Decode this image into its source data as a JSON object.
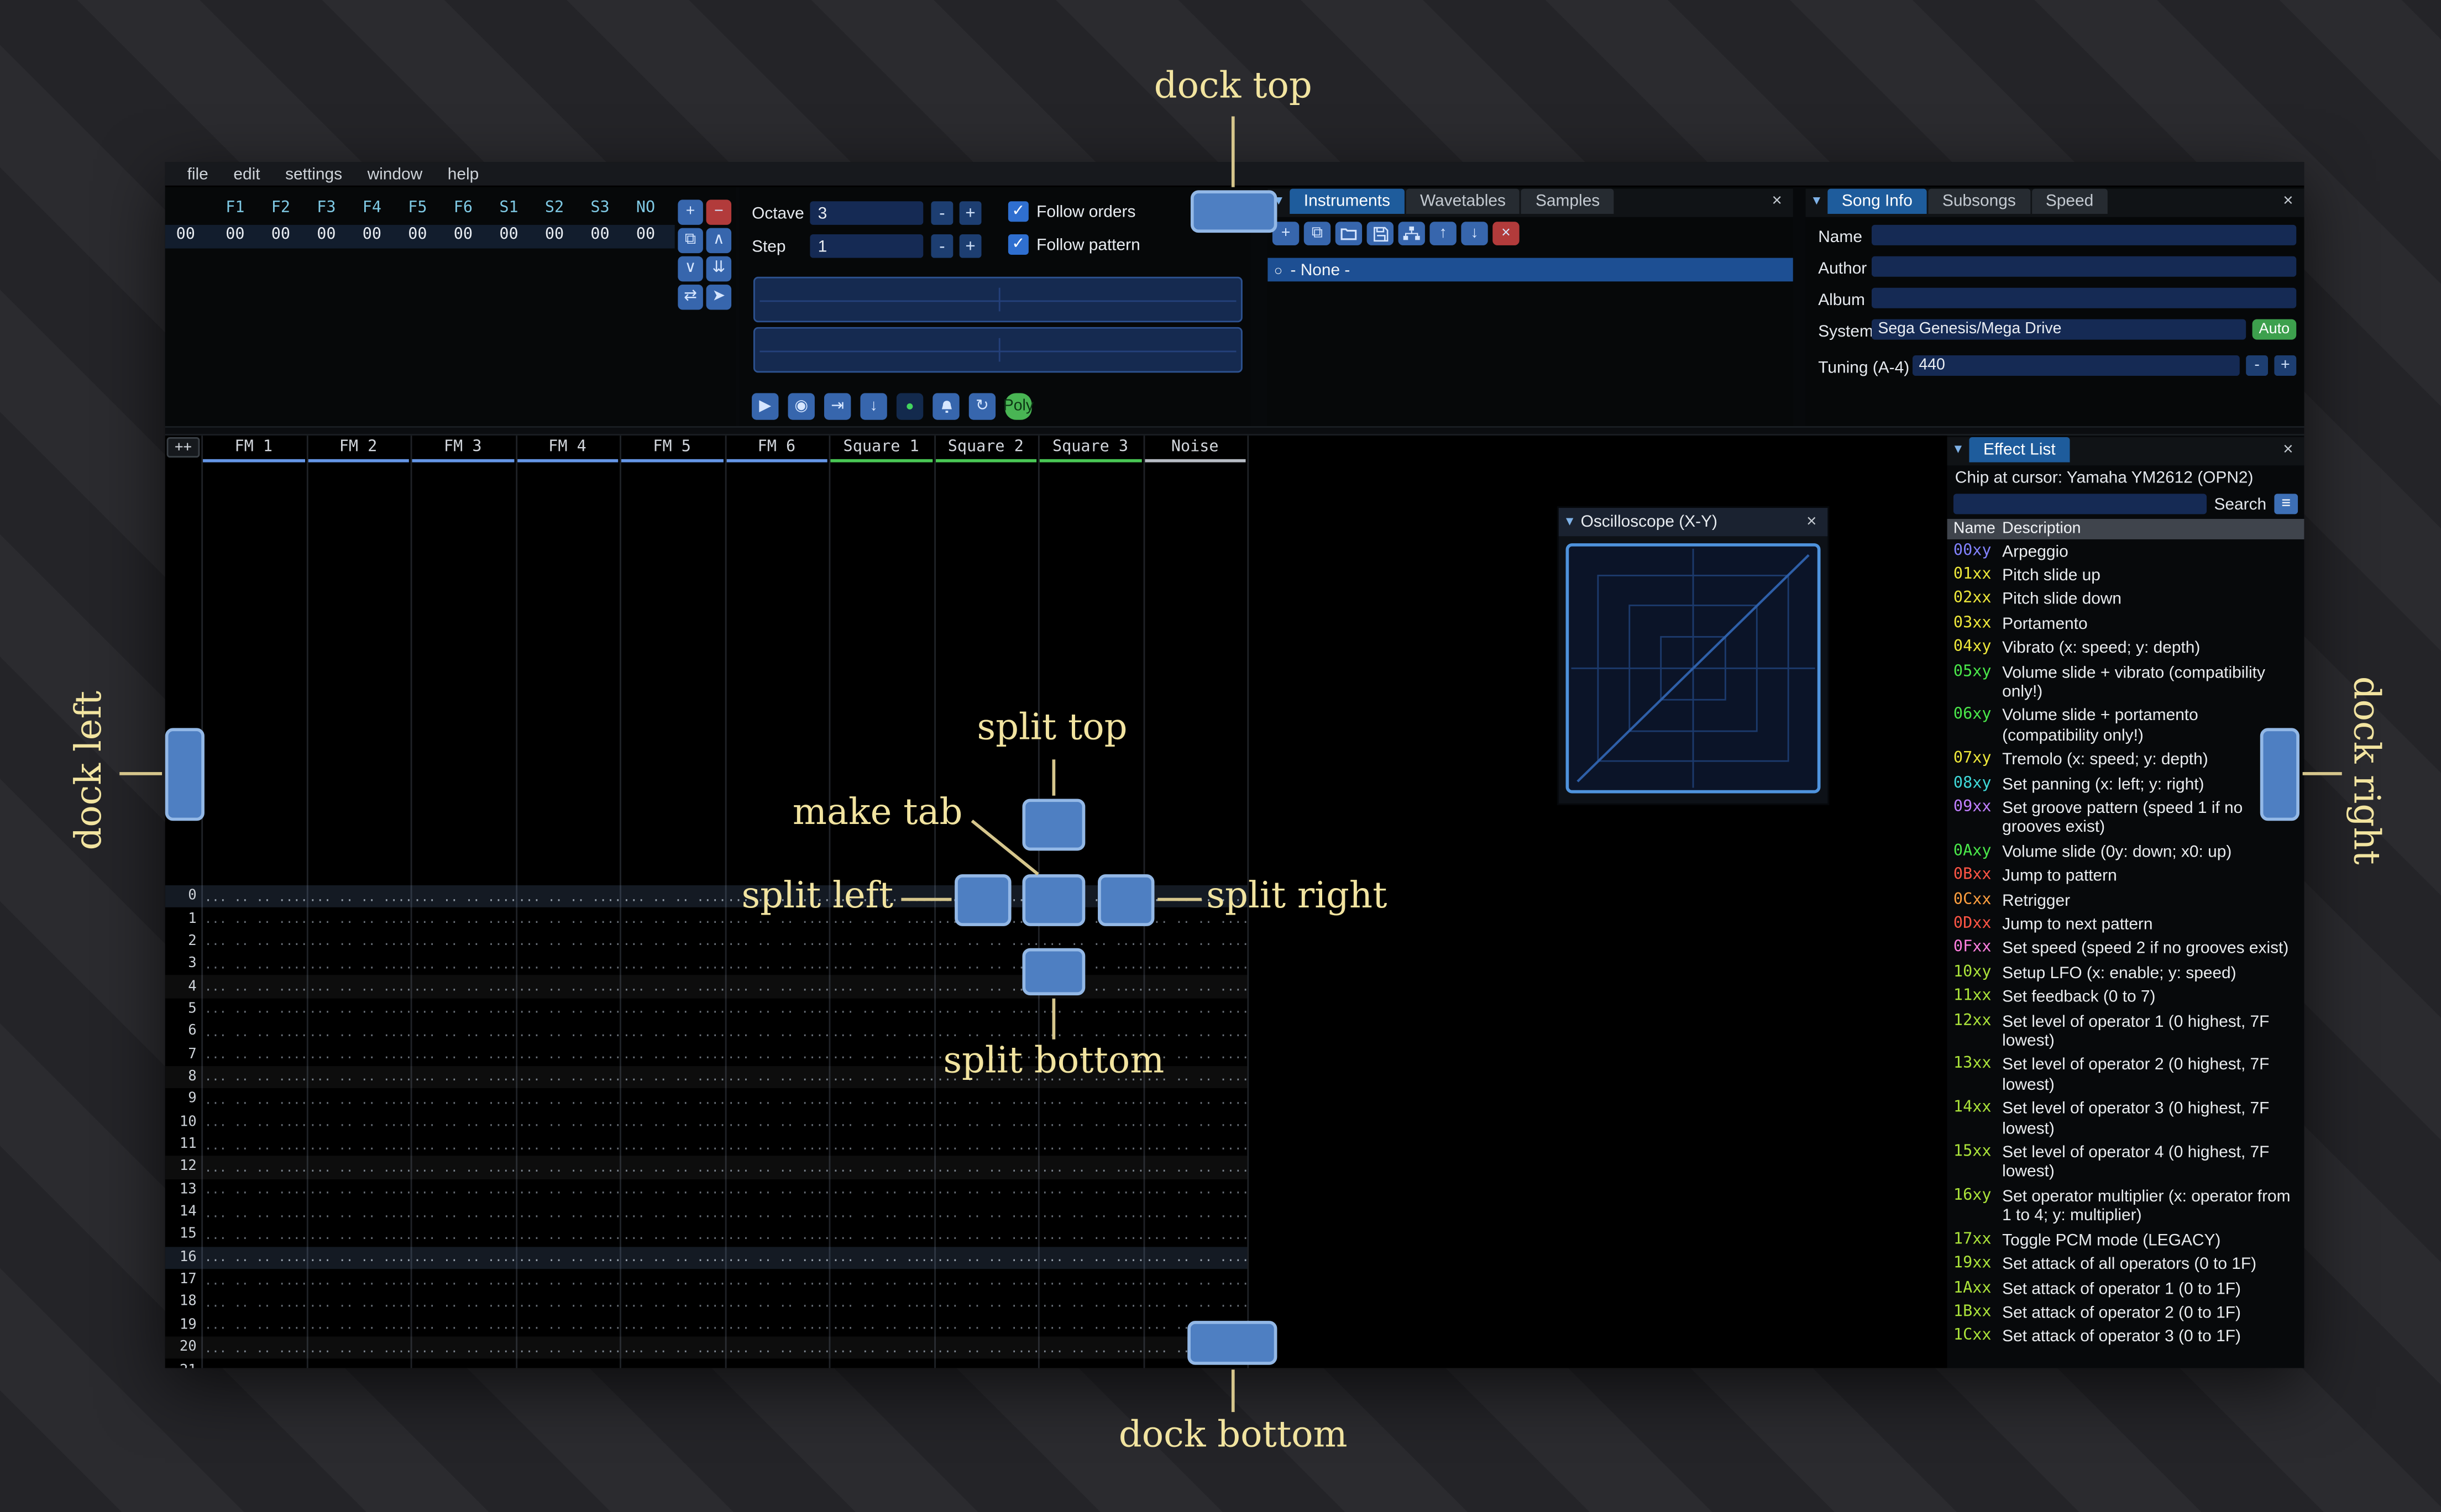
{
  "glyphs": {
    "collapse": "▼",
    "close": "×",
    "check": "✓",
    "radio": "○",
    "burger": "≡"
  },
  "menu": {
    "items": [
      "file",
      "edit",
      "settings",
      "window",
      "help"
    ]
  },
  "order_list": {
    "columns": [
      "F1",
      "F2",
      "F3",
      "F4",
      "F5",
      "F6",
      "S1",
      "S2",
      "S3",
      "NO"
    ],
    "row_index": "00",
    "row_values": [
      "00",
      "00",
      "00",
      "00",
      "00",
      "00",
      "00",
      "00",
      "00",
      "00"
    ],
    "buttons": [
      {
        "name": "order-add-button",
        "glyph": "+"
      },
      {
        "name": "order-remove-button",
        "glyph": "−",
        "variant": "danger"
      },
      {
        "name": "order-duplicate-button",
        "glyph": "⧉"
      },
      {
        "name": "order-move-up-button",
        "glyph": "∧"
      },
      {
        "name": "order-move-down-button",
        "glyph": "∨"
      },
      {
        "name": "order-duplicate-end-button",
        "glyph": "⇊"
      },
      {
        "name": "order-change-mode-button",
        "glyph": "⇄"
      },
      {
        "name": "order-edit-mode-button",
        "glyph": "➤"
      }
    ]
  },
  "playback": {
    "octave_label": "Octave",
    "octave_value": "3",
    "step_label": "Step",
    "step_value": "1",
    "minus_label": "-",
    "plus_label": "+",
    "follow_orders_label": "Follow orders",
    "follow_pattern_label": "Follow pattern",
    "transport": [
      {
        "name": "play-button",
        "glyph": "▶"
      },
      {
        "name": "play-from-start-button",
        "glyph": "◉"
      },
      {
        "name": "play-from-cursor-button",
        "glyph": "⇥"
      },
      {
        "name": "step-row-button",
        "glyph": "↓"
      },
      {
        "name": "edit-toggle-button",
        "glyph": "●",
        "variant": "edit"
      },
      {
        "name": "metronome-button",
        "icon": "bell"
      },
      {
        "name": "repeat-pattern-button",
        "glyph": "↻"
      },
      {
        "name": "poly-button",
        "label": "Poly",
        "variant": "poly"
      }
    ]
  },
  "instruments": {
    "tabs": [
      "Instruments",
      "Wavetables",
      "Samples"
    ],
    "active_tab": "Instruments",
    "toolbar": [
      {
        "name": "add-instrument-button",
        "glyph": "+"
      },
      {
        "name": "duplicate-instrument-button",
        "glyph": "⧉"
      },
      {
        "name": "open-instrument-button",
        "icon": "folder"
      },
      {
        "name": "save-instrument-button",
        "icon": "floppy"
      },
      {
        "name": "instrument-folders-button",
        "icon": "sitemap"
      },
      {
        "name": "move-instrument-up-button",
        "glyph": "↑"
      },
      {
        "name": "move-instrument-down-button",
        "glyph": "↓"
      },
      {
        "name": "delete-instrument-button",
        "glyph": "×",
        "variant": "danger"
      }
    ],
    "list": [
      {
        "label": "- None -"
      }
    ]
  },
  "song_info": {
    "tabs": [
      "Song Info",
      "Subsongs",
      "Speed"
    ],
    "active_tab": "Song Info",
    "fields": [
      {
        "label": "Name",
        "value": ""
      },
      {
        "label": "Author",
        "value": ""
      },
      {
        "label": "Album",
        "value": ""
      },
      {
        "label": "System",
        "value": "Sega Genesis/Mega Drive",
        "button": "Auto"
      },
      {
        "label": "Tuning (A-4)",
        "value": "440"
      }
    ]
  },
  "pattern": {
    "expand_label": "++",
    "visible_rows": 22,
    "empty_cell": "... .. .. ....",
    "channels": [
      {
        "name": "FM 1",
        "color": "#6596e6"
      },
      {
        "name": "FM 2",
        "color": "#6596e6"
      },
      {
        "name": "FM 3",
        "color": "#6596e6"
      },
      {
        "name": "FM 4",
        "color": "#6596e6"
      },
      {
        "name": "FM 5",
        "color": "#6596e6"
      },
      {
        "name": "FM 6",
        "color": "#6596e6"
      },
      {
        "name": "Square 1",
        "color": "#49c754"
      },
      {
        "name": "Square 2",
        "color": "#49c754"
      },
      {
        "name": "Square 3",
        "color": "#49c754"
      },
      {
        "name": "Noise",
        "color": "#b6bcc4"
      }
    ]
  },
  "oscilloscope": {
    "title": "Oscilloscope (X-Y)"
  },
  "effect_list": {
    "title": "Effect List",
    "chip_line": "Chip at cursor: Yamaha YM2612 (OPN2)",
    "search_label": "Search",
    "name_header": "Name",
    "desc_header": "Description",
    "effects": [
      {
        "code": "00xy",
        "color": "#8282ff",
        "desc": "Arpeggio"
      },
      {
        "code": "01xx",
        "color": "#eee83a",
        "desc": "Pitch slide up"
      },
      {
        "code": "02xx",
        "color": "#eee83a",
        "desc": "Pitch slide down"
      },
      {
        "code": "03xx",
        "color": "#eee83a",
        "desc": "Portamento"
      },
      {
        "code": "04xy",
        "color": "#eee83a",
        "desc": "Vibrato (x: speed; y: depth)"
      },
      {
        "code": "05xy",
        "color": "#4ae84a",
        "desc": "Volume slide + vibrato (compatibility only!)"
      },
      {
        "code": "06xy",
        "color": "#4ae84a",
        "desc": "Volume slide + portamento (compatibility only!)"
      },
      {
        "code": "07xy",
        "color": "#eee83a",
        "desc": "Tremolo (x: speed; y: depth)"
      },
      {
        "code": "08xy",
        "color": "#3fd9d9",
        "desc": "Set panning (x: left; y: right)"
      },
      {
        "code": "09xx",
        "color": "#c07fff",
        "desc": "Set groove pattern (speed 1 if no grooves exist)"
      },
      {
        "code": "0Axy",
        "color": "#4ae84a",
        "desc": "Volume slide (0y: down; x0: up)"
      },
      {
        "code": "0Bxx",
        "color": "#ff5545",
        "desc": "Jump to pattern"
      },
      {
        "code": "0Cxx",
        "color": "#ff9f3f",
        "desc": "Retrigger"
      },
      {
        "code": "0Dxx",
        "color": "#ff5545",
        "desc": "Jump to next pattern"
      },
      {
        "code": "0Fxx",
        "color": "#ff7fdf",
        "desc": "Set speed (speed 2 if no grooves exist)"
      },
      {
        "code": "10xy",
        "color": "#abe33a",
        "desc": "Setup LFO (x: enable; y: speed)"
      },
      {
        "code": "11xx",
        "color": "#abe33a",
        "desc": "Set feedback (0 to 7)"
      },
      {
        "code": "12xx",
        "color": "#abe33a",
        "desc": "Set level of operator 1 (0 highest, 7F lowest)"
      },
      {
        "code": "13xx",
        "color": "#abe33a",
        "desc": "Set level of operator 2 (0 highest, 7F lowest)"
      },
      {
        "code": "14xx",
        "color": "#abe33a",
        "desc": "Set level of operator 3 (0 highest, 7F lowest)"
      },
      {
        "code": "15xx",
        "color": "#abe33a",
        "desc": "Set level of operator 4 (0 highest, 7F lowest)"
      },
      {
        "code": "16xy",
        "color": "#abe33a",
        "desc": "Set operator multiplier (x: operator from 1 to 4; y: multiplier)"
      },
      {
        "code": "17xx",
        "color": "#abe33a",
        "desc": "Toggle PCM mode (LEGACY)"
      },
      {
        "code": "19xx",
        "color": "#abe33a",
        "desc": "Set attack of all operators (0 to 1F)"
      },
      {
        "code": "1Axx",
        "color": "#abe33a",
        "desc": "Set attack of operator 1 (0 to 1F)"
      },
      {
        "code": "1Bxx",
        "color": "#abe33a",
        "desc": "Set attack of operator 2 (0 to 1F)"
      },
      {
        "code": "1Cxx",
        "color": "#abe33a",
        "desc": "Set attack of operator 3 (0 to 1F)"
      }
    ]
  },
  "annotations": {
    "dock_top": "dock top",
    "dock_left": "dock left",
    "dock_right": "dock right",
    "dock_bottom": "dock bottom",
    "split_top": "split top",
    "split_left": "split left",
    "split_right": "split right",
    "split_bottom": "split bottom",
    "make_tab": "make tab"
  }
}
